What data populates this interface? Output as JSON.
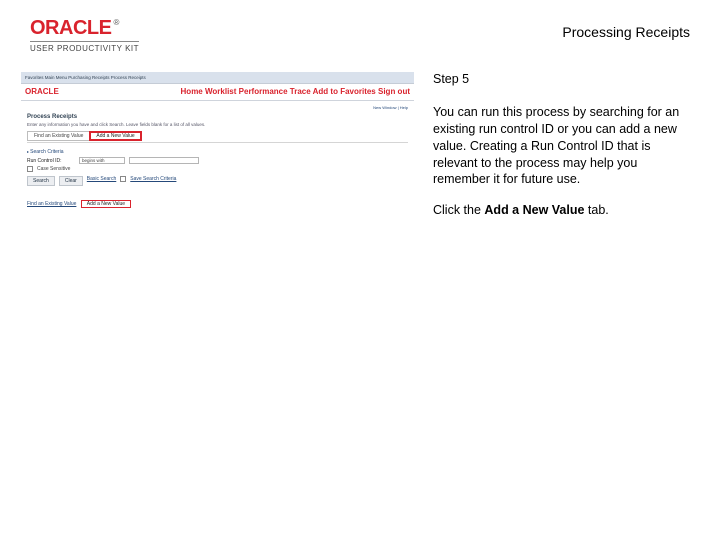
{
  "header": {
    "logo": "ORACLE",
    "logo_tm": "®",
    "logo_sub": "USER PRODUCTIVITY KIT",
    "page_title": "Processing Receipts"
  },
  "thumb": {
    "breadcrumb": "Favorites    Main Menu    Purchasing    Receipts    Process Receipts",
    "nav_items": [
      "Home",
      "Worklist",
      "Performance Trace",
      "Add to Favorites",
      "Sign out"
    ],
    "logo": "ORACLE",
    "nw_label": "New Window | Help",
    "page_h": "Process Receipts",
    "page_sub": "Enter any information you have and click Search. Leave fields blank for a list of all values.",
    "tab_existing": "Find an Existing Value",
    "tab_new": "Add a New Value",
    "section": "Search Criteria",
    "field_label": "Run Control ID:",
    "field_op": "begins with",
    "case_label": "Case Sensitive",
    "btn_search": "Search",
    "btn_clear": "Clear",
    "basic_link": "Basic Search",
    "save_link": "Save Search Criteria",
    "footer_existing": "Find an Existing Value",
    "footer_new": "Add a New Value"
  },
  "panel": {
    "step": "Step 5",
    "para": "You can run this process by searching for an existing run control ID or you can add a new value. Creating a Run Control ID that is relevant to the process may help you remember it for future use.",
    "action_pre": "Click the ",
    "action_bold": "Add a New Value",
    "action_post": " tab."
  }
}
